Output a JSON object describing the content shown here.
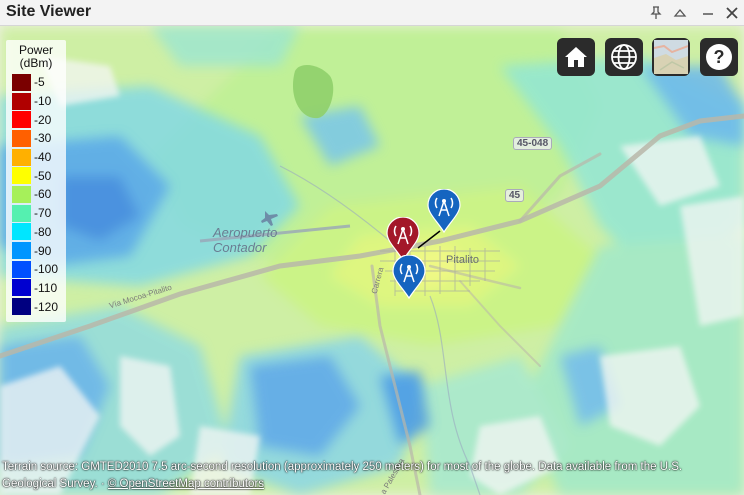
{
  "window": {
    "title": "Site Viewer",
    "controls": [
      "pin-icon",
      "collapse-icon",
      "minimize-icon",
      "close-icon"
    ]
  },
  "legend": {
    "title_line1": "Power",
    "title_line2": "(dBm)",
    "items": [
      {
        "label": "-5",
        "color": "#7a0000"
      },
      {
        "label": "-10",
        "color": "#b00000"
      },
      {
        "label": "-20",
        "color": "#ff0000"
      },
      {
        "label": "-30",
        "color": "#ff6000"
      },
      {
        "label": "-40",
        "color": "#ffb000"
      },
      {
        "label": "-50",
        "color": "#ffff00"
      },
      {
        "label": "-60",
        "color": "#a6f05a"
      },
      {
        "label": "-70",
        "color": "#55f0b0"
      },
      {
        "label": "-80",
        "color": "#00e6ff"
      },
      {
        "label": "-90",
        "color": "#0096ff"
      },
      {
        "label": "-100",
        "color": "#0050ff"
      },
      {
        "label": "-110",
        "color": "#0000d0"
      },
      {
        "label": "-120",
        "color": "#000080"
      }
    ]
  },
  "map_buttons": [
    {
      "name": "home-button",
      "icon": "home-icon"
    },
    {
      "name": "globe-button",
      "icon": "globe-icon"
    },
    {
      "name": "basemap-button",
      "icon": "satellite-icon"
    },
    {
      "name": "help-button",
      "icon": "help-icon"
    }
  ],
  "map_labels": {
    "airport_line1": "Aeropuerto",
    "airport_line2": "Contador",
    "town": "Pitalito",
    "road_45_048": "45-048",
    "road_45": "45",
    "via_left": "Vía Mocoa-Pitalito",
    "via_bottom": "Vía a Palestina",
    "street": "Carrera"
  },
  "sites": [
    {
      "type": "transmitter",
      "color": "#a31829"
    },
    {
      "type": "receiver",
      "color": "#1565c0"
    },
    {
      "type": "receiver",
      "color": "#1565c0"
    }
  ],
  "attribution": {
    "line1": "Terrain source: GMTED2010 7.5 arc-second resolution (approximately 250 meters) for most of the globe. Data available from the U.S.",
    "line2_prefix": "Geological Survey. · ",
    "osm_link": "© OpenStreetMap contributors"
  }
}
